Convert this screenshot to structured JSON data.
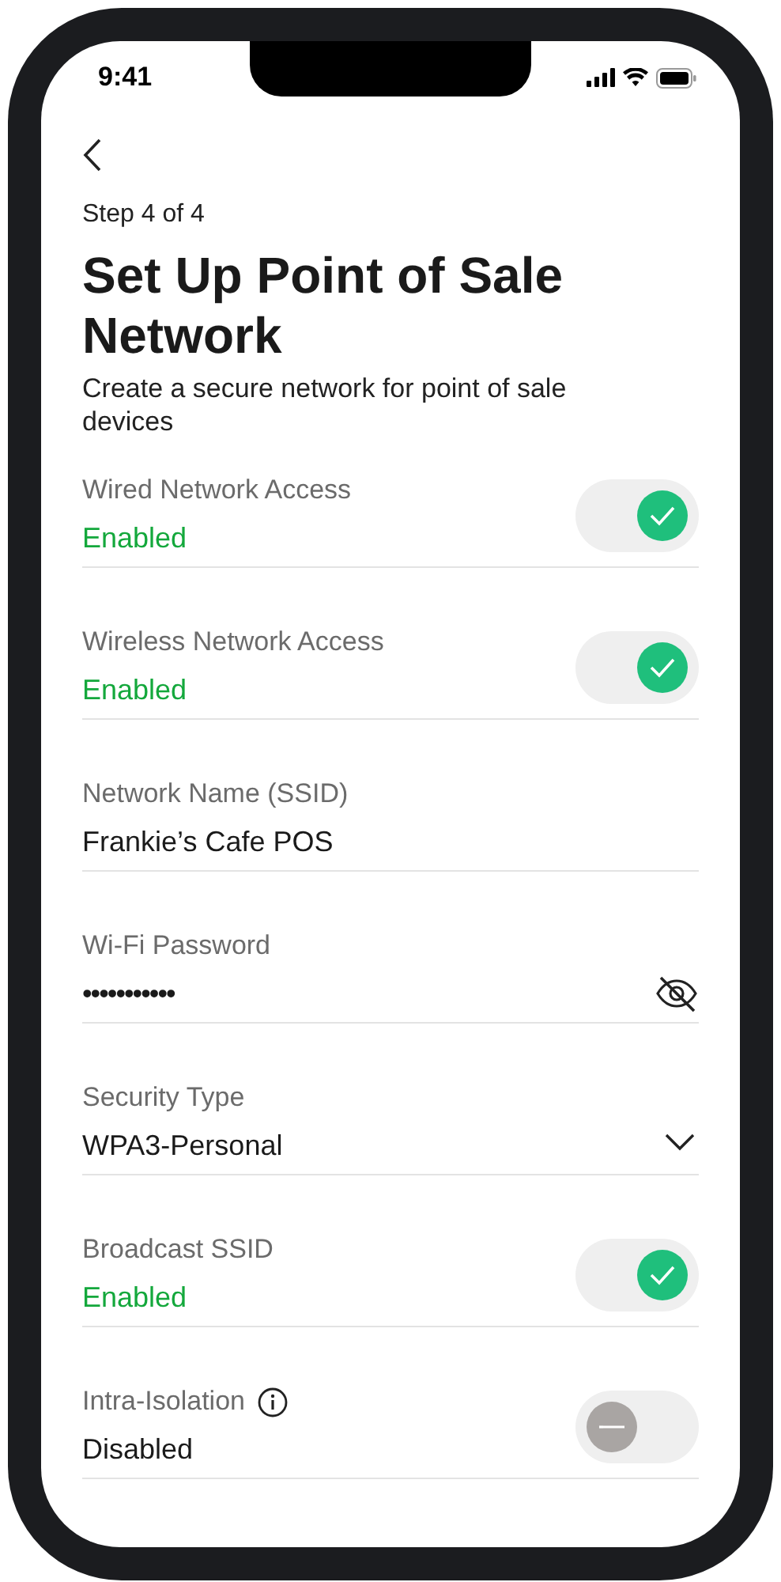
{
  "status_bar": {
    "time": "9:41"
  },
  "step": "Step 4 of 4",
  "title": "Set Up Point of Sale Network",
  "subtitle": "Create a secure network for point of sale devices",
  "fields": [
    {
      "kind": "toggle",
      "label": "Wired Network Access",
      "value": "Enabled",
      "on": true
    },
    {
      "kind": "toggle",
      "label": "Wireless Network Access",
      "value": "Enabled",
      "on": true
    },
    {
      "kind": "text",
      "label": "Network Name (SSID)",
      "value": "Frankie’s Cafe POS"
    },
    {
      "kind": "password",
      "label": "Wi-Fi Password",
      "value": "•••••••••••",
      "revealed": false
    },
    {
      "kind": "select",
      "label": "Security Type",
      "value": "WPA3-Personal"
    },
    {
      "kind": "toggle",
      "label": "Broadcast SSID",
      "value": "Enabled",
      "on": true
    },
    {
      "kind": "toggle",
      "label": "Intra-Isolation",
      "value": "Disabled",
      "on": false,
      "info": true
    }
  ]
}
